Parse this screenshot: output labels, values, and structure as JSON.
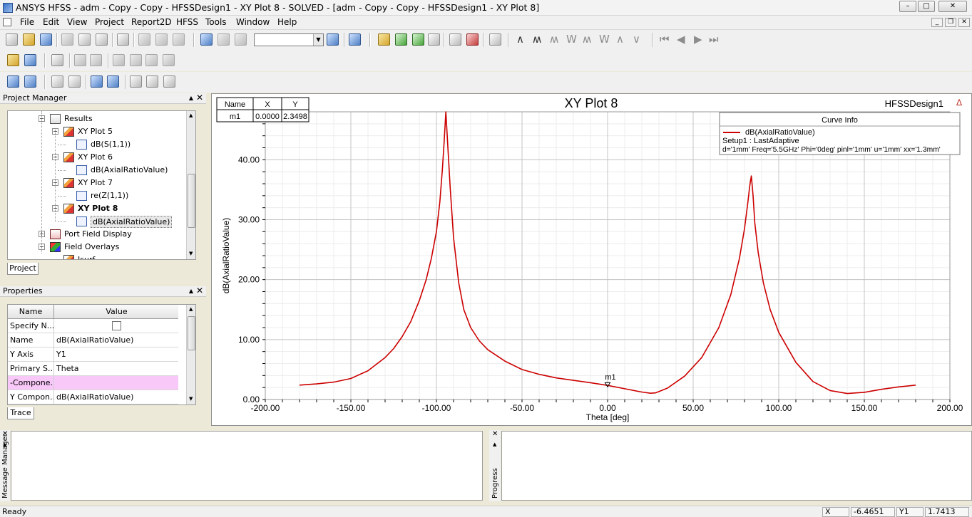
{
  "window": {
    "title": "ANSYS HFSS - adm - Copy - Copy - HFSSDesign1 - XY Plot 8 - SOLVED - [adm - Copy - Copy - HFSSDesign1 - XY Plot 8]",
    "controls": {
      "minimize": "–",
      "maximize": "□",
      "close": "✕"
    }
  },
  "menu": {
    "items": [
      "File",
      "Edit",
      "View",
      "Project",
      "Report2D",
      "HFSS",
      "Tools",
      "Window",
      "Help"
    ],
    "mdi_controls": {
      "minimize": "_",
      "restore": "❒",
      "close": "✕"
    }
  },
  "toolbar": {
    "combo_value": "",
    "combo_arrow": "▼",
    "wave_icons": [
      "∧",
      "ʍ",
      "ʍ",
      "W",
      "ʍ",
      "W",
      "∧",
      "∨"
    ],
    "nav_icons": [
      "⏮",
      "◀",
      "▶",
      "⏭"
    ]
  },
  "project_manager": {
    "title": "Project Manager",
    "pin": "▲",
    "close": "✕",
    "tab": "Project",
    "tree": [
      {
        "label": "Results",
        "level": 0,
        "icon": "res",
        "expander": "−",
        "bold": false
      },
      {
        "label": "XY Plot 5",
        "level": 1,
        "icon": "plot",
        "expander": "−",
        "bold": false
      },
      {
        "label": "dB(S(1,1))",
        "level": 2,
        "icon": "trace",
        "expander": "",
        "bold": false
      },
      {
        "label": "XY Plot 6",
        "level": 1,
        "icon": "plot",
        "expander": "−",
        "bold": false
      },
      {
        "label": "dB(AxialRatioValue)",
        "level": 2,
        "icon": "trace",
        "expander": "",
        "bold": false
      },
      {
        "label": "XY Plot 7",
        "level": 1,
        "icon": "plot",
        "expander": "−",
        "bold": false
      },
      {
        "label": "re(Z(1,1))",
        "level": 2,
        "icon": "trace",
        "expander": "",
        "bold": false
      },
      {
        "label": "XY Plot 8",
        "level": 1,
        "icon": "plot",
        "expander": "−",
        "bold": true
      },
      {
        "label": "dB(AxialRatioValue)",
        "level": 2,
        "icon": "trace",
        "expander": "",
        "bold": false,
        "selected": true
      },
      {
        "label": "Port Field Display",
        "level": 0,
        "icon": "port",
        "expander": "+",
        "bold": false
      },
      {
        "label": "Field Overlays",
        "level": 0,
        "icon": "field",
        "expander": "−",
        "bold": false
      },
      {
        "label": "Jsurf",
        "level": 1,
        "icon": "plot",
        "expander": "",
        "bold": false
      }
    ],
    "scroll_up": "▲",
    "scroll_down": "▼"
  },
  "properties": {
    "title": "Properties",
    "pin": "▲",
    "close": "✕",
    "tab": "Trace",
    "headers": [
      "Name",
      "Value"
    ],
    "rows": [
      {
        "name": "Specify N...",
        "value": "",
        "checkbox": true,
        "highlight": false
      },
      {
        "name": "Name",
        "value": "dB(AxialRatioValue)",
        "checkbox": false,
        "highlight": false
      },
      {
        "name": "Y Axis",
        "value": "Y1",
        "checkbox": false,
        "highlight": false
      },
      {
        "name": "Primary S...",
        "value": "Theta",
        "checkbox": false,
        "highlight": false
      },
      {
        "name": "-Compone...",
        "value": "",
        "checkbox": false,
        "highlight": true
      },
      {
        "name": "Y Compon...",
        "value": "dB(AxialRatioValue)",
        "checkbox": false,
        "highlight": false
      }
    ],
    "scroll_up": "▲",
    "scroll_down": "▼"
  },
  "plot": {
    "title": "XY Plot 8",
    "design_label": "HFSSDesign1",
    "logo_glyph": "∆",
    "marker_table": {
      "headers": [
        "Name",
        "X",
        "Y"
      ],
      "rows": [
        [
          "m1",
          "0.0000",
          "2.3498"
        ]
      ]
    },
    "legend": {
      "title": "Curve Info",
      "trace": "dB(AxialRatioValue)",
      "setup": "Setup1 : LastAdaptive",
      "params": "d='1mm' Freq='5.5GHz' Phi='0deg' pinl='1mm' u='1mm' xx='1.3mm'"
    },
    "marker_label": "m1"
  },
  "chart_data": {
    "type": "line",
    "title": "XY Plot 8",
    "xlabel": "Theta [deg]",
    "ylabel": "dB(AxialRatioValue)",
    "xlim": [
      -200,
      200
    ],
    "ylim": [
      0,
      48
    ],
    "xticks": [
      "-200.00",
      "-150.00",
      "-100.00",
      "-50.00",
      "0.00",
      "50.00",
      "100.00",
      "150.00",
      "200.00"
    ],
    "yticks": [
      "0.00",
      "10.00",
      "20.00",
      "30.00",
      "40.00"
    ],
    "grid": true,
    "series": [
      {
        "name": "dB(AxialRatioValue)",
        "color": "#cc0000",
        "x": [
          -180,
          -170,
          -160,
          -150,
          -140,
          -130,
          -125,
          -120,
          -115,
          -110,
          -106,
          -103,
          -100,
          -98,
          -96.5,
          -95.5,
          -94.5,
          -93.5,
          -92,
          -90,
          -87,
          -84,
          -80,
          -75,
          -70,
          -60,
          -50,
          -40,
          -30,
          -20,
          -10,
          0,
          10,
          20,
          25,
          28,
          35,
          45,
          55,
          65,
          72,
          77,
          80,
          82,
          83,
          83.5,
          84,
          85,
          86,
          88,
          91,
          95,
          100,
          110,
          120,
          130,
          140,
          150,
          160,
          170,
          180
        ],
        "y": [
          2.4,
          2.6,
          2.9,
          3.5,
          4.8,
          7.0,
          8.5,
          10.5,
          13.0,
          16.5,
          20.0,
          23.5,
          28.0,
          33.0,
          38.5,
          43.0,
          48.0,
          43.0,
          35.5,
          27.0,
          19.5,
          15.0,
          12.0,
          9.8,
          8.3,
          6.4,
          5.0,
          4.2,
          3.6,
          3.2,
          2.8,
          2.35,
          1.8,
          1.25,
          1.05,
          1.1,
          1.9,
          3.9,
          7.0,
          12.0,
          17.5,
          23.5,
          28.5,
          33.0,
          35.5,
          36.5,
          37.3,
          34.0,
          29.5,
          24.5,
          19.5,
          15.0,
          11.2,
          6.2,
          3.0,
          1.5,
          1.0,
          1.2,
          1.7,
          2.1,
          2.4
        ]
      }
    ],
    "marker": {
      "name": "m1",
      "x": 0.0,
      "y": 2.3498
    }
  },
  "message_panel": {
    "label": "Message Manager",
    "close": "✕",
    "pin": "▲"
  },
  "progress_panel": {
    "label": "Progress",
    "close": "✕",
    "pin": "▲"
  },
  "status": {
    "text": "Ready",
    "x_label": "X",
    "x_value": "-6.4651",
    "y_label": "Y1",
    "y_value": "1.7413"
  }
}
